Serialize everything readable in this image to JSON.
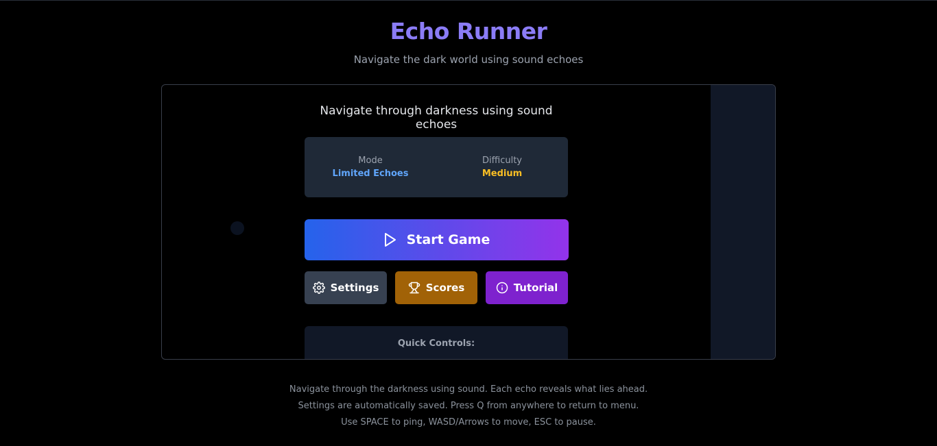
{
  "header": {
    "title": "Echo Runner",
    "subtitle": "Navigate the dark world using sound echoes"
  },
  "menu": {
    "heading": "Navigate through darkness using sound echoes",
    "info": {
      "mode_label": "Mode",
      "mode_value": "Limited Echoes",
      "difficulty_label": "Difficulty",
      "difficulty_value": "Medium"
    },
    "start_label": "Start Game",
    "buttons": {
      "settings": "Settings",
      "scores": "Scores",
      "tutorial": "Tutorial"
    },
    "quick_controls_title": "Quick Controls:"
  },
  "footer": {
    "line1": "Navigate through the darkness using sound. Each echo reveals what lies ahead.",
    "line2": "Settings are automatically saved. Press Q from anywhere to return to menu.",
    "line3": "Use SPACE to ping, WASD/Arrows to move, ESC to pause."
  },
  "icons": {
    "start": "play-icon",
    "settings": "gear-icon",
    "scores": "trophy-icon",
    "tutorial": "info-icon"
  },
  "colors": {
    "title": "#8b7cf6",
    "mode": "#60a5fa",
    "difficulty": "#fbbf24",
    "start_gradient_from": "#2563eb",
    "start_gradient_to": "#9333ea",
    "settings_bg": "#374151",
    "scores_bg": "#a16207",
    "tutorial_bg": "#7e22ce"
  }
}
